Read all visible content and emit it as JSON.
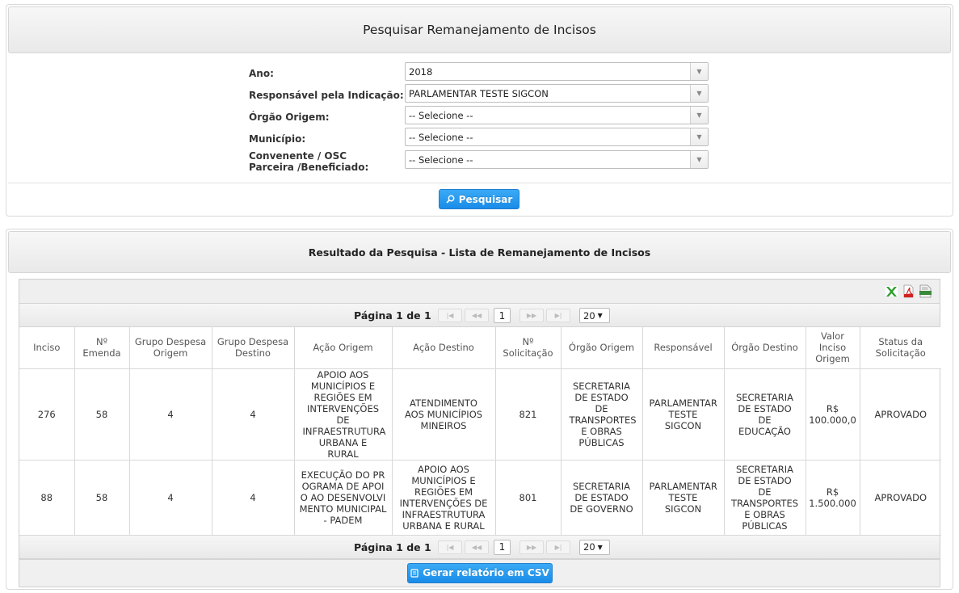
{
  "search_panel": {
    "title": "Pesquisar Remanejamento de Incisos",
    "fields": [
      {
        "label": "Ano:",
        "value": "2018"
      },
      {
        "label": "Responsável pela Indicação:",
        "value": "PARLAMENTAR TESTE SIGCON"
      },
      {
        "label": "Órgão Origem:",
        "value": "-- Selecione --"
      },
      {
        "label": "Município:",
        "value": "-- Selecione --"
      },
      {
        "label": "Convenente / OSC Parceira /Beneficiado:",
        "value": "-- Selecione --"
      }
    ],
    "search_button": "Pesquisar"
  },
  "results_panel": {
    "title": "Resultado da Pesquisa - Lista de Remanejamento de Incisos",
    "export_icons": [
      "excel-icon",
      "pdf-icon",
      "csv-icon"
    ],
    "pager": {
      "text": "Página 1 de 1",
      "current_page": "1",
      "page_size": "20"
    },
    "columns": [
      "Inciso",
      "Nº Emenda",
      "Grupo Despesa Origem",
      "Grupo Despesa Destino",
      "Ação Origem",
      "Ação Destino",
      "Nº Solicitação",
      "Órgão Origem",
      "Responsável",
      "Órgão Destino",
      "Valor Inciso Origem",
      "Status da Solicitação"
    ],
    "rows": [
      [
        "276",
        "58",
        "4",
        "4",
        "APOIO AOS MUNICÍPIOS E REGIÕES EM INTERVENÇÕES DE INFRAESTRUTURA URBANA E RURAL",
        "ATENDIMENTO AOS MUNICÍPIOS MINEIROS",
        "821",
        "SECRETARIA DE ESTADO DE TRANSPORTES E OBRAS PÚBLICAS",
        "PARLAMENTAR TESTE SIGCON",
        "SECRETARIA DE ESTADO DE EDUCAÇÃO",
        "R$ 100.000,0",
        "APROVADO"
      ],
      [
        "88",
        "58",
        "4",
        "4",
        "EXECUÇÃO DO PROGRAMA DE APOIO AO DESENVOLVIMENTO MUNICIPAL - PADEM",
        "APOIO AOS MUNICÍPIOS E REGIÕES EM INTERVENÇÕES DE INFRAESTRUTURA URBANA E RURAL",
        "801",
        "SECRETARIA DE ESTADO DE GOVERNO",
        "PARLAMENTAR TESTE SIGCON",
        "SECRETARIA DE ESTADO DE TRANSPORTES E OBRAS PÚBLICAS",
        "R$ 1.500.000",
        "APROVADO"
      ]
    ],
    "csv_button": "Gerar relatório em CSV"
  }
}
